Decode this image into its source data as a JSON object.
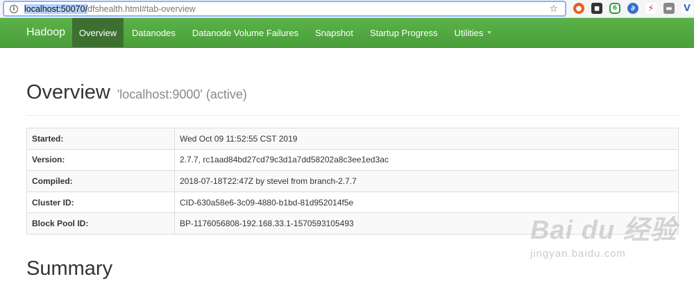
{
  "browser": {
    "url_host": "localhost:50070/",
    "url_rest": "dfshealth.html#tab-overview"
  },
  "navbar": {
    "brand": "Hadoop",
    "items": [
      {
        "label": "Overview"
      },
      {
        "label": "Datanodes"
      },
      {
        "label": "Datanode Volume Failures"
      },
      {
        "label": "Snapshot"
      },
      {
        "label": "Startup Progress"
      },
      {
        "label": "Utilities"
      }
    ]
  },
  "overview": {
    "title": "Overview",
    "subtitle": "'localhost:9000' (active)"
  },
  "info_table": {
    "rows": [
      {
        "label": "Started:",
        "value": "Wed Oct 09 11:52:55 CST 2019"
      },
      {
        "label": "Version:",
        "value": "2.7.7, rc1aad84bd27cd79c3d1a7dd58202a8c3ee1ed3ac"
      },
      {
        "label": "Compiled:",
        "value": "2018-07-18T22:47Z by stevel from branch-2.7.7"
      },
      {
        "label": "Cluster ID:",
        "value": "CID-630a58e6-3c09-4880-b1bd-81d952014f5e"
      },
      {
        "label": "Block Pool ID:",
        "value": "BP-1176056808-192.168.33.1-1570593105493"
      }
    ]
  },
  "summary": {
    "title": "Summary"
  },
  "watermark": {
    "logo": "Bai du 经验",
    "sub": "jingyan.baidu.com"
  },
  "icons": [
    "info-icon",
    "star-icon",
    "extension-icons"
  ],
  "colors": {
    "navbar": "#4b9e3b",
    "active_nav": "#3d7030"
  }
}
